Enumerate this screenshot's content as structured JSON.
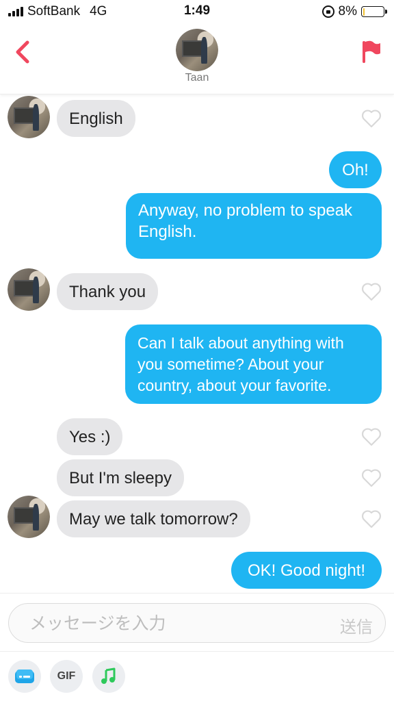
{
  "status_bar": {
    "carrier": "SoftBank",
    "network": "4G",
    "time": "1:49",
    "battery": "8%",
    "battery_level": 0.08,
    "battery_color": "#f2c230"
  },
  "header": {
    "contact_name": "Taan",
    "back_icon": "chevron-left-icon",
    "flag_icon": "flag-icon",
    "accent_color": "#f0475e"
  },
  "messages": [
    {
      "side": "in",
      "text": "English"
    },
    {
      "side": "out",
      "text": "Oh!"
    },
    {
      "side": "out",
      "text": "Anyway, no problem to speak English."
    },
    {
      "side": "in",
      "text": "Thank you"
    },
    {
      "side": "out",
      "text": "Can I talk about anything with you sometime? About your country, about your favorite."
    },
    {
      "side": "in",
      "text": "Yes :)"
    },
    {
      "side": "in",
      "text": "But I'm sleepy"
    },
    {
      "side": "in",
      "text": "May we talk tomorrow?"
    },
    {
      "side": "out",
      "text": "OK! Good night!"
    }
  ],
  "composer": {
    "placeholder": "メッセージを入力",
    "send_label": "送信",
    "gif_label": "GIF"
  },
  "colors": {
    "outgoing_bubble": "#1fb5f2",
    "incoming_bubble": "#e6e6e8",
    "music_icon": "#2ec95b"
  }
}
